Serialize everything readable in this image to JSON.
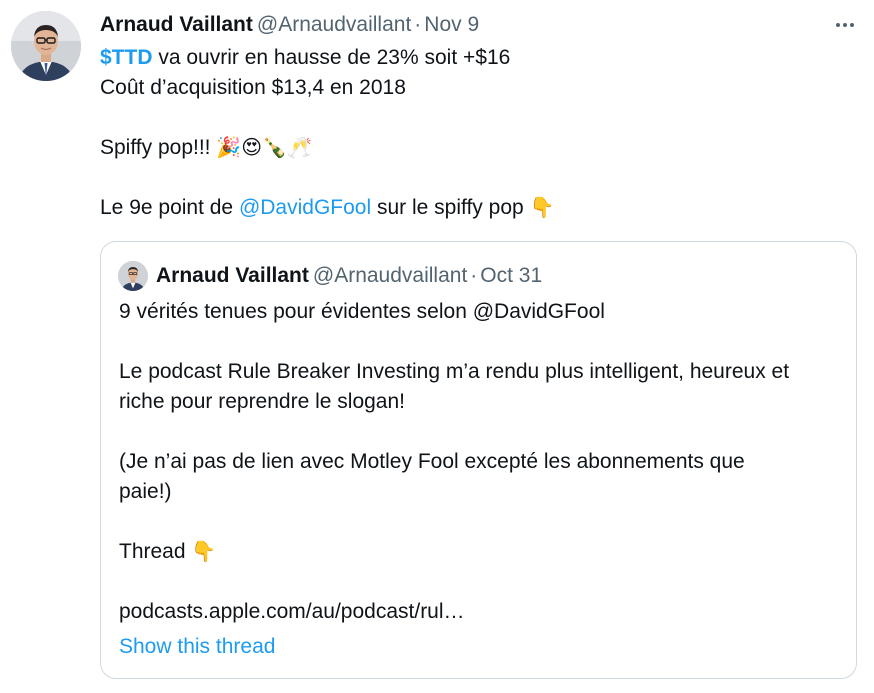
{
  "tweet": {
    "author_name": "Arnaud Vaillant",
    "author_handle": "@Arnaudvaillant",
    "separator": "·",
    "date": "Nov 9",
    "more_icon": "more-horizontal-icon",
    "line1_cashtag": "$TTD",
    "line1_rest": " va ouvrir en hausse de 23% soit +$16",
    "line2": "Coût d’acquisition $13,4 en 2018",
    "line3_text": "Spiffy pop!!! ",
    "line3_emojis": "🎉😍🍾🥂",
    "line4_prefix": "Le 9e point de ",
    "line4_mention": "@DavidGFool",
    "line4_suffix": " sur le spiffy pop ",
    "line4_emoji": "👇"
  },
  "quote": {
    "author_name": "Arnaud Vaillant",
    "author_handle": "@Arnaudvaillant",
    "separator": "·",
    "date": "Oct 31",
    "lines": [
      "9 vérités tenues pour évidentes selon @DavidGFool",
      "Le podcast Rule Breaker Investing m’a rendu plus intelligent, heureux et",
      "riche pour reprendre le slogan!",
      "(Je n’ai pas de lien avec Motley Fool excepté les abonnements que",
      "paie!)",
      "Thread ",
      "podcasts.apple.com/au/podcast/rul…"
    ],
    "thread_emoji": "👇",
    "show_thread": "Show this thread"
  },
  "colors": {
    "link": "#1d9bf0",
    "secondary_text": "#536471",
    "border": "#cfd9de"
  }
}
